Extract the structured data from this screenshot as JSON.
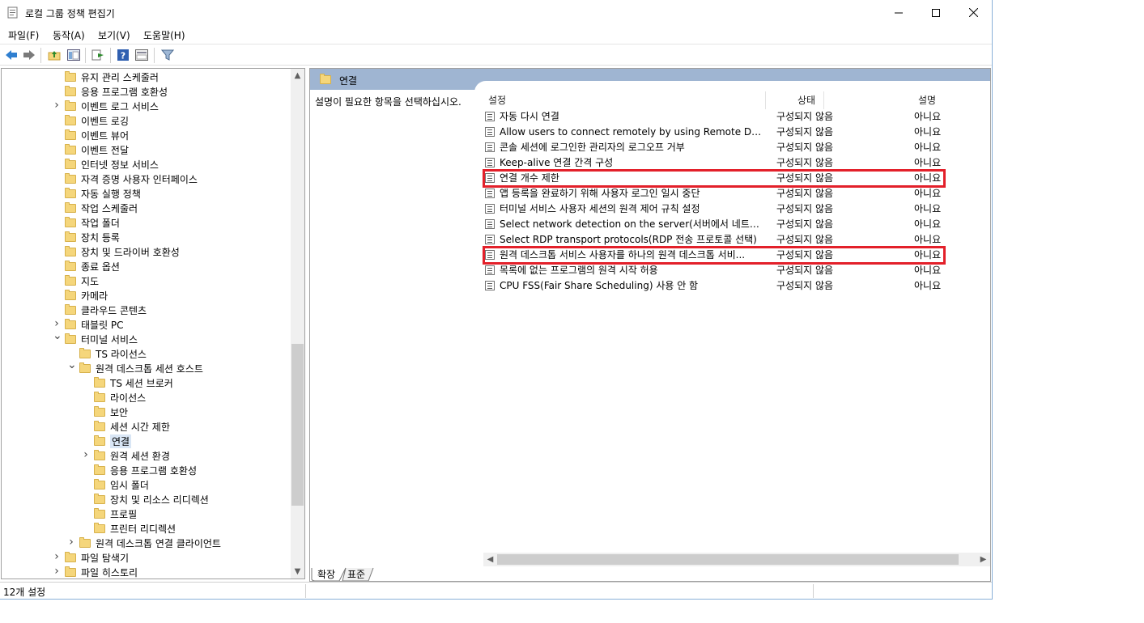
{
  "window": {
    "title": "로컬 그룹 정책 편집기"
  },
  "menu": [
    "파일(F)",
    "동작(A)",
    "보기(V)",
    "도움말(H)"
  ],
  "tree": {
    "items": [
      "유지 관리 스케줄러",
      "응용 프로그램 호환성",
      "이벤트 로그 서비스",
      "이벤트 로깅",
      "이벤트 뷰어",
      "이벤트 전달",
      "인터넷 정보 서비스",
      "자격 증명 사용자 인터페이스",
      "자동 실행 정책",
      "작업 스케줄러",
      "작업 폴더",
      "장치 등록",
      "장치 및 드라이버 호환성",
      "종료 옵션",
      "지도",
      "카메라",
      "클라우드 콘텐츠",
      "태블릿 PC",
      "터미널 서비스",
      "TS 라이선스",
      "원격 데스크톱 세션 호스트",
      "TS 세션 브로커",
      "라이선스",
      "보안",
      "세션 시간 제한",
      "연결",
      "원격 세션 환경",
      "응용 프로그램 호환성",
      "임시 폴더",
      "장치 및 리소스 리디렉션",
      "프로필",
      "프린터 리디렉션",
      "원격 데스크톱 연결 클라이언트",
      "파일 탐색기",
      "파일 히스토리"
    ]
  },
  "right": {
    "header_title": "연결",
    "description": "설명이 필요한 항목을 선택하십시오.",
    "columns": {
      "setting": "설정",
      "state": "상태",
      "comment": "설명"
    },
    "rows": [
      {
        "name": "자동 다시 연결",
        "state": "구성되지 않음",
        "comment": "아니요"
      },
      {
        "name": "Allow users to connect remotely by using Remote Desktop...",
        "state": "구성되지 않음",
        "comment": "아니요"
      },
      {
        "name": "콘솔 세션에 로그인한 관리자의 로그오프 거부",
        "state": "구성되지 않음",
        "comment": "아니요"
      },
      {
        "name": "Keep-alive 연결 간격 구성",
        "state": "구성되지 않음",
        "comment": "아니요"
      },
      {
        "name": "연결 개수 제한",
        "state": "구성되지 않음",
        "comment": "아니요"
      },
      {
        "name": "앱 등록을 완료하기 위해 사용자 로그인 일시 중단",
        "state": "구성되지 않음",
        "comment": "아니요"
      },
      {
        "name": "터미널 서비스 사용자 세션의 원격 제어 규칙 설정",
        "state": "구성되지 않음",
        "comment": "아니요"
      },
      {
        "name": "Select network detection on the server(서버에서 네트워크 ...",
        "state": "구성되지 않음",
        "comment": "아니요"
      },
      {
        "name": "Select RDP transport protocols(RDP 전송 프로토콜 선택)",
        "state": "구성되지 않음",
        "comment": "아니요"
      },
      {
        "name": "원격 데스크톱 서비스 사용자를 하나의 원격 데스크톱 서비...",
        "state": "구성되지 않음",
        "comment": "아니요"
      },
      {
        "name": "목록에 없는 프로그램의 원격 시작 허용",
        "state": "구성되지 않음",
        "comment": "아니요"
      },
      {
        "name": "CPU FSS(Fair Share Scheduling) 사용 안 함",
        "state": "구성되지 않음",
        "comment": "아니요"
      }
    ],
    "tabs": [
      "확장",
      "표준"
    ]
  },
  "status": {
    "text": "12개 설정"
  }
}
